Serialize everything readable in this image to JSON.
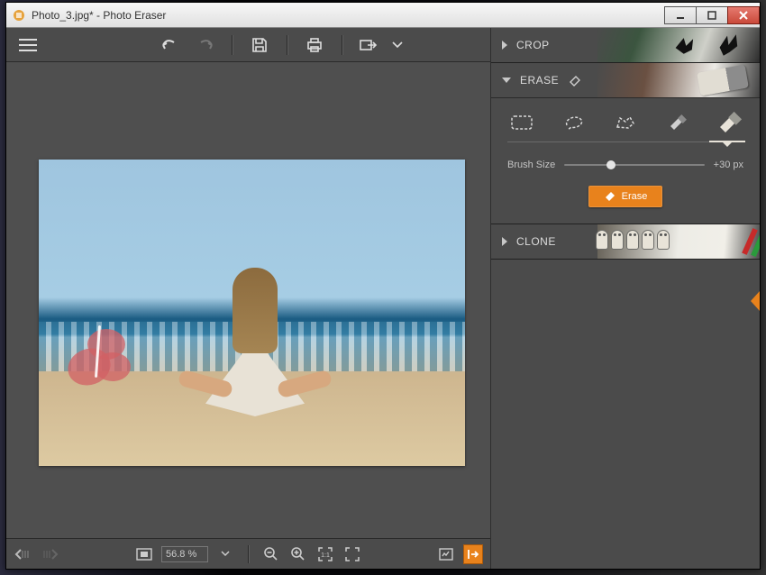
{
  "window": {
    "title": "Photo_3.jpg* - Photo Eraser"
  },
  "toolbar": {
    "menu": "menu",
    "undo": "undo",
    "redo": "redo",
    "save": "save",
    "print": "print",
    "export": "export"
  },
  "panels": {
    "crop": {
      "label": "CROP",
      "expanded": false
    },
    "erase": {
      "label": "ERASE",
      "expanded": true,
      "tools": [
        "rect-select",
        "lasso-select",
        "polygon-select",
        "brush-small",
        "brush-large"
      ],
      "active_tool_index": 4,
      "brush_label": "Brush Size",
      "brush_value": 30,
      "brush_display": "+30 px",
      "brush_min": 0,
      "brush_max": 100,
      "erase_button": "Erase"
    },
    "clone": {
      "label": "CLONE",
      "expanded": false
    }
  },
  "statusbar": {
    "zoom_value": "56.8 %",
    "history_back": "history-back",
    "history_fwd": "history-forward",
    "fit": "fit-screen",
    "zoom_out": "zoom-out",
    "zoom_in": "zoom-in",
    "fullscreen": "fullscreen",
    "fullscreen_alt": "fullscreen-compare",
    "compare": "compare",
    "export_side": "export"
  },
  "canvas": {
    "filename": "Photo_3.jpg"
  }
}
